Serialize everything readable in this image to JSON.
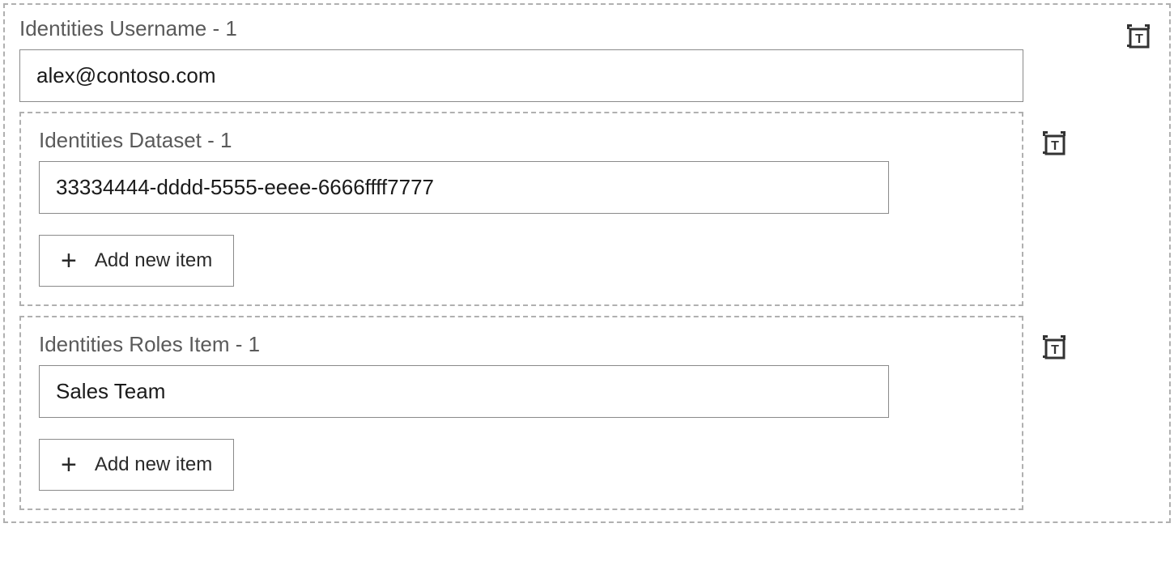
{
  "sections": {
    "username": {
      "label": "Identities Username - 1",
      "value": "alex@contoso.com"
    },
    "dataset": {
      "label": "Identities Dataset - 1",
      "value": "33334444-dddd-5555-eeee-6666ffff7777",
      "add_label": "Add new item"
    },
    "roles": {
      "label": "Identities Roles Item - 1",
      "value": "Sales Team",
      "add_label": "Add new item"
    }
  }
}
